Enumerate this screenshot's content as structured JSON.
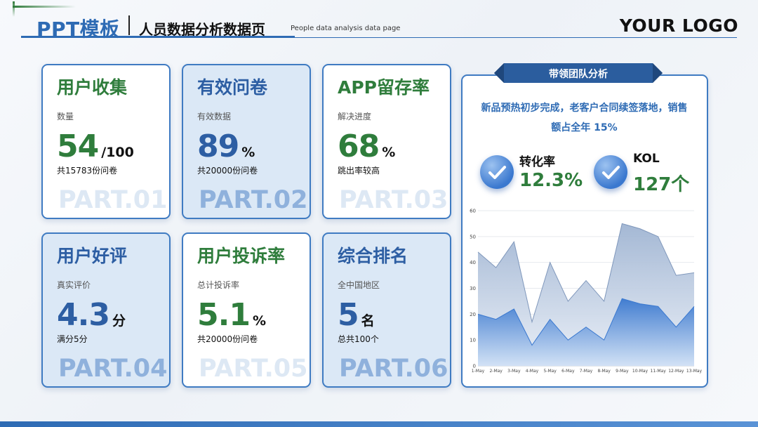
{
  "header": {
    "title": "PPT模板",
    "subtitle": "人员数据分析数据页",
    "subtitle_en": "People data analysis data page",
    "logo": "YOUR LOGO"
  },
  "cards": [
    {
      "title": "用户收集",
      "label": "数量",
      "value": "54",
      "unit": "/100",
      "note": "共15783份问卷",
      "part": "PART.01"
    },
    {
      "title": "有效问卷",
      "label": "有效数据",
      "value": "89",
      "unit": "%",
      "note": "共20000份问卷",
      "part": "PART.02"
    },
    {
      "title": "APP留存率",
      "label": "解决进度",
      "value": "68",
      "unit": "%",
      "note": "跳出率较高",
      "part": "PART.03"
    },
    {
      "title": "用户好评",
      "label": "真实评价",
      "value": "4.3",
      "unit": "分",
      "note": "满分5分",
      "part": "PART.04"
    },
    {
      "title": "用户投诉率",
      "label": "总计投诉率",
      "value": "5.1",
      "unit": "%",
      "note": "共20000份问卷",
      "part": "PART.05"
    },
    {
      "title": "综合排名",
      "label": "全中国地区",
      "value": "5",
      "unit": "名",
      "note": "总共100个",
      "part": "PART.06"
    }
  ],
  "panel": {
    "ribbon": "带领团队分析",
    "description": "新品预热初步完成，老客户合同续签落地，销售额占全年 15%",
    "kpis": [
      {
        "label": "转化率",
        "value": "12.3%",
        "icon": "check-icon"
      },
      {
        "label": "KOL",
        "value": "127个",
        "icon": "check-icon"
      }
    ]
  },
  "colors": {
    "primary": "#2e6bb4",
    "green": "#2f7d3c",
    "card_blue": "#dbe8f6"
  },
  "chart_data": {
    "type": "area",
    "x": [
      "1-May",
      "2-May",
      "3-May",
      "4-May",
      "5-May",
      "6-May",
      "7-May",
      "8-May",
      "9-May",
      "10-May",
      "11-May",
      "12-May",
      "13-May"
    ],
    "ylim": [
      0,
      60
    ],
    "yticks": [
      0,
      10,
      20,
      30,
      40,
      50,
      60
    ],
    "grid": true,
    "series": [
      {
        "values": [
          44,
          38,
          48,
          17,
          40,
          25,
          33,
          25,
          55,
          53,
          50,
          35,
          36
        ],
        "color": "#9fb4d2"
      },
      {
        "values": [
          20,
          18,
          22,
          8,
          18,
          10,
          15,
          10,
          26,
          24,
          23,
          15,
          23
        ],
        "color": "#3a78cf"
      }
    ]
  }
}
